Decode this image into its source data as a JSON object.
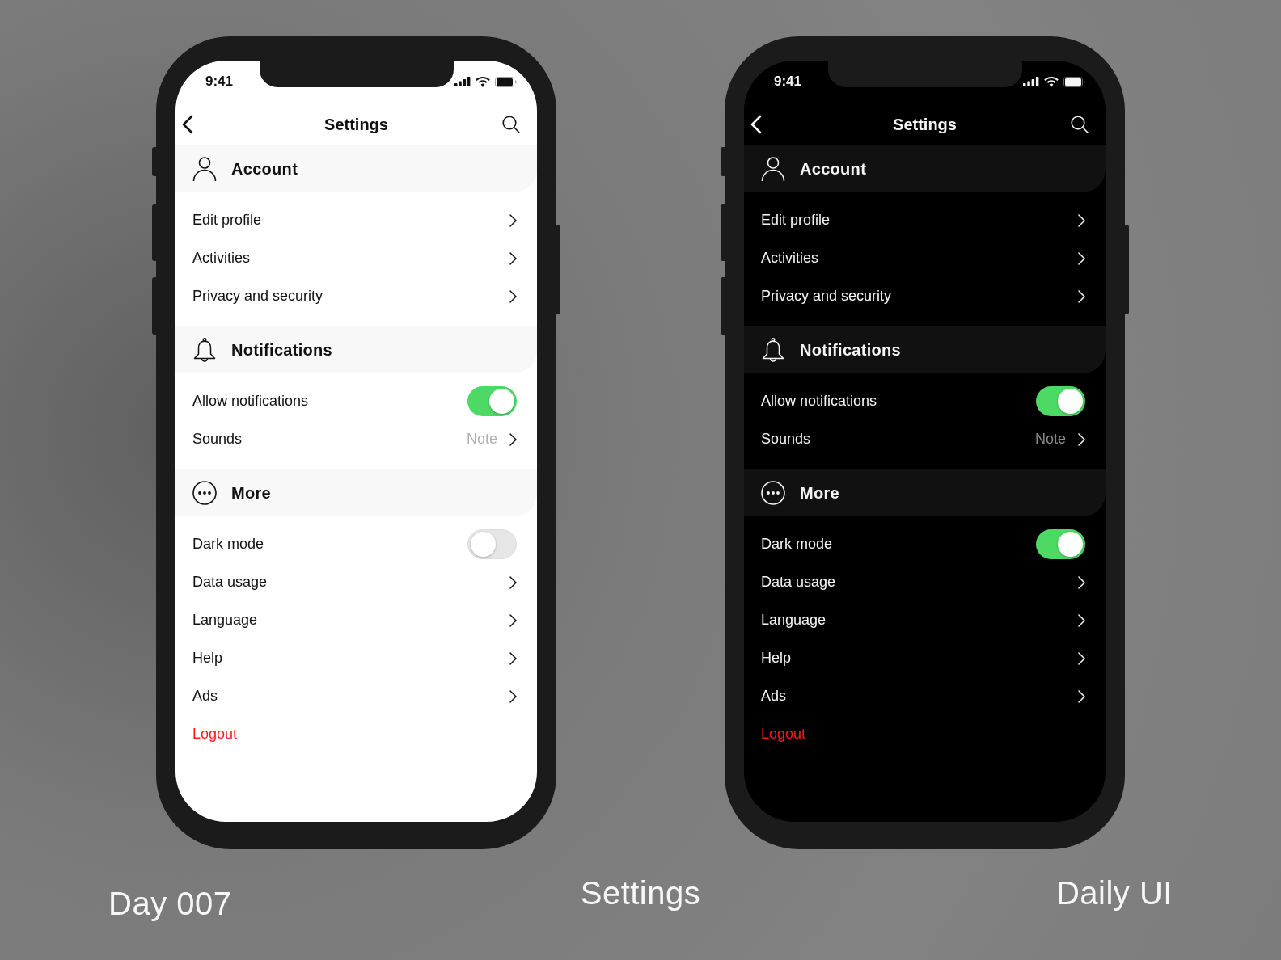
{
  "phones": [
    {
      "dark": false,
      "status_bar": {
        "time": "9:41"
      },
      "header": {
        "title": "Settings"
      },
      "sections": [
        {
          "title": "Account",
          "rows": [
            {
              "kind": "link",
              "label": "Edit profile"
            },
            {
              "kind": "link",
              "label": "Activities"
            },
            {
              "kind": "link",
              "label": "Privacy and security"
            }
          ]
        },
        {
          "title": "Notifications",
          "rows": [
            {
              "kind": "toggle",
              "label": "Allow notifications",
              "on": true
            },
            {
              "kind": "link",
              "label": "Sounds",
              "value": "Note"
            }
          ]
        },
        {
          "title": "More",
          "rows": [
            {
              "kind": "toggle",
              "label": "Dark mode",
              "on": false
            },
            {
              "kind": "link",
              "label": "Data usage"
            },
            {
              "kind": "link",
              "label": "Language"
            },
            {
              "kind": "link",
              "label": "Help"
            },
            {
              "kind": "link",
              "label": "Ads"
            },
            {
              "kind": "action",
              "label": "Logout"
            }
          ]
        }
      ]
    },
    {
      "dark": true,
      "status_bar": {
        "time": "9:41"
      },
      "header": {
        "title": "Settings"
      },
      "sections": [
        {
          "title": "Account",
          "rows": [
            {
              "kind": "link",
              "label": "Edit profile"
            },
            {
              "kind": "link",
              "label": "Activities"
            },
            {
              "kind": "link",
              "label": "Privacy and security"
            }
          ]
        },
        {
          "title": "Notifications",
          "rows": [
            {
              "kind": "toggle",
              "label": "Allow notifications",
              "on": true
            },
            {
              "kind": "link",
              "label": "Sounds",
              "value": "Note"
            }
          ]
        },
        {
          "title": "More",
          "rows": [
            {
              "kind": "toggle",
              "label": "Dark mode",
              "on": true
            },
            {
              "kind": "link",
              "label": "Data usage"
            },
            {
              "kind": "link",
              "label": "Language"
            },
            {
              "kind": "link",
              "label": "Help"
            },
            {
              "kind": "link",
              "label": "Ads"
            },
            {
              "kind": "action",
              "label": "Logout"
            }
          ]
        }
      ]
    }
  ],
  "captions": [
    "Day 007",
    "Settings",
    "Daily UI"
  ]
}
